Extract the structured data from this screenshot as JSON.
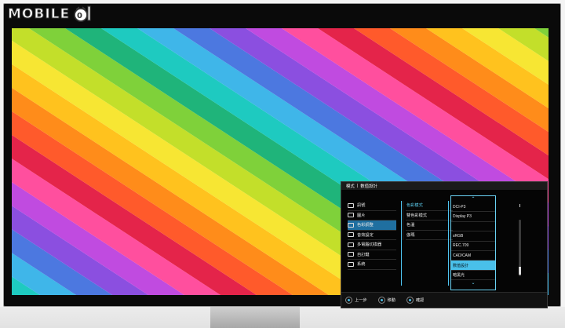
{
  "watermark": {
    "text": "MOBILE"
  },
  "osd": {
    "breadcrumb": [
      "模式",
      "數值設計"
    ],
    "menu": [
      {
        "icon": "input-icon",
        "label": "訊號"
      },
      {
        "icon": "picture-icon",
        "label": "圖片"
      },
      {
        "icon": "color-icon",
        "label": "色彩調整",
        "active": true
      },
      {
        "icon": "audio-icon",
        "label": "音效設定"
      },
      {
        "icon": "multi-screen-icon",
        "label": "多電腦切換器"
      },
      {
        "icon": "user-icon",
        "label": "自訂鍵"
      },
      {
        "icon": "system-icon",
        "label": "系統"
      }
    ],
    "submenu": [
      {
        "label": "色彩模式",
        "active": true
      },
      {
        "label": "雙色彩模式"
      },
      {
        "label": "色溫"
      },
      {
        "label": "伽瑪"
      }
    ],
    "options": [
      {
        "label": "DCI-P3"
      },
      {
        "label": "Display P3"
      },
      {
        "label": "",
        "disabled": true
      },
      {
        "label": "sRGB"
      },
      {
        "label": "REC.709"
      },
      {
        "label": "CAD/CAM"
      },
      {
        "label": "數值設計",
        "selected": true
      },
      {
        "label": "暗黑光"
      }
    ],
    "footer": [
      {
        "icon": "joystick-left-icon",
        "label": "上一步"
      },
      {
        "icon": "joystick-move-icon",
        "label": "移動"
      },
      {
        "icon": "joystick-press-icon",
        "label": "確認"
      }
    ]
  },
  "colors": {
    "stripes": [
      "#ff4f9e",
      "#e4244a",
      "#ff5a2b",
      "#ff8c1a",
      "#ffc21e",
      "#f7e633",
      "#c3df2a",
      "#7fd13a",
      "#1fb47a",
      "#1ecac0",
      "#3fb6e9",
      "#4c78e0",
      "#8b4fe0",
      "#c04be0"
    ],
    "accent": "#49c0ea"
  }
}
